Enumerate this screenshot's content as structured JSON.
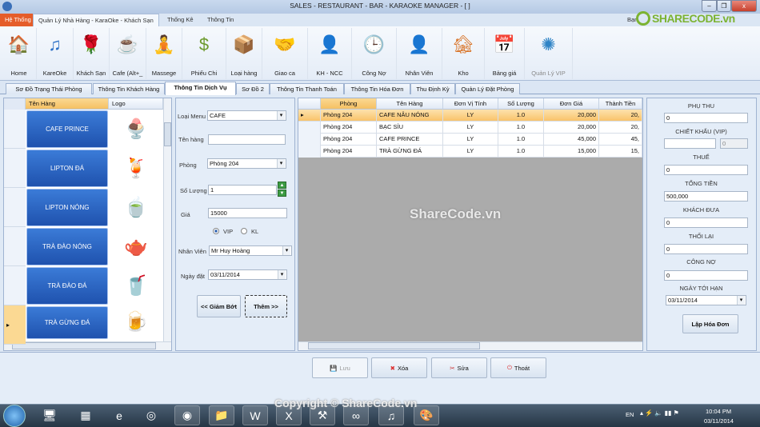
{
  "window": {
    "title": "SALES - RESTAURANT - BAR - KARAOKE MANAGER - [      ]",
    "minimize": "–",
    "restore": "❐",
    "close": "x"
  },
  "menu": {
    "tabs": [
      "Hệ Thống",
      "Quản Lý Nhà Hàng - KaraOke - Khách Sạn",
      "Thống Kê",
      "Thông Tin"
    ],
    "right_text": "Bạn"
  },
  "ribbon": [
    {
      "label": "Home",
      "icon": "house-icon",
      "glyph": "🏠"
    },
    {
      "label": "KareOke",
      "icon": "music-note-icon",
      "glyph": "♫"
    },
    {
      "label": "Khách Sạn",
      "icon": "rose-icon",
      "glyph": "🌹"
    },
    {
      "label": "Cafe (Alt+_",
      "icon": "coffee-cup-icon",
      "glyph": "☕"
    },
    {
      "label": "Massege",
      "icon": "yoga-icon",
      "glyph": "🧘"
    },
    {
      "label": "Phiếu Chi",
      "icon": "money-icon",
      "glyph": "$"
    },
    {
      "label": "Loại hàng",
      "icon": "box-icon",
      "glyph": "📦"
    },
    {
      "label": "Giao ca",
      "icon": "handshake-icon",
      "glyph": "🤝"
    },
    {
      "label": "KH - NCC",
      "icon": "businessman-icon",
      "glyph": "👤"
    },
    {
      "label": "Công Nợ",
      "icon": "clock-icon",
      "glyph": "🕒"
    },
    {
      "label": "Nhân Viên",
      "icon": "employee-icon",
      "glyph": "👤"
    },
    {
      "label": "Kho",
      "icon": "warehouse-icon",
      "glyph": "🏚"
    },
    {
      "label": "Bảng giá",
      "icon": "calendar-icon",
      "glyph": "📅"
    },
    {
      "label": "Quản Lý VIP",
      "icon": "vip-swirl-icon",
      "glyph": "✺"
    }
  ],
  "page_tabs": [
    "Sơ Đồ Trạng Thái Phòng",
    "Thông Tin Khách Hàng",
    "Thông Tin Dịch Vụ",
    "Sơ Đồ 2",
    "Thông Tin Thanh Toán",
    "Thông Tin Hóa Đơn",
    "Thu Định Kỳ",
    "Quản Lý Đặt Phòng"
  ],
  "active_tab": "Thông Tin Dịch Vụ",
  "menu_grid": {
    "headers": [
      "Tên Hàng",
      "Logo"
    ],
    "items": [
      {
        "name": "CAFE PRINCE",
        "logo": "🍨"
      },
      {
        "name": "LIPTON ĐÁ",
        "logo": "🍹"
      },
      {
        "name": "LIPTON NÓNG",
        "logo": "🍵"
      },
      {
        "name": "TRÀ ĐÀO NÓNG",
        "logo": "🫖"
      },
      {
        "name": "TRÀ ĐÀO ĐÁ",
        "logo": "🥤"
      },
      {
        "name": "TRÀ GỪNG ĐÁ",
        "logo": "🍺"
      }
    ]
  },
  "form": {
    "loai_menu_label": "Loại Menu",
    "loai_menu": "CAFE",
    "ten_hang_label": "Tên hàng",
    "ten_hang": "",
    "phong_label": "Phòng",
    "phong": "Phòng 204",
    "so_luong_label": "Số Lượng",
    "so_luong": "1",
    "gia_label": "Giá",
    "gia": "15000",
    "radio_vip": "VIP",
    "radio_kl": "KL",
    "radio_selected": "VIP",
    "nhan_vien_label": "Nhân Viên",
    "nhan_vien": "Mr Huy Hoàng",
    "ngay_dat_label": "Ngày đặt",
    "ngay_dat": "03/11/2014",
    "giam_bot": "<< Giảm Bớt",
    "them": "Thêm >>"
  },
  "order_grid": {
    "headers": [
      "Phòng",
      "Tên Hàng",
      "Đơn Vị Tính",
      "Số Lượng",
      "Đơn Giá",
      "Thành Tiền"
    ],
    "rows": [
      [
        "Phòng 204",
        "CAFE NÂU NÓNG",
        "LY",
        "1.0",
        "20,000",
        "20,"
      ],
      [
        "Phòng 204",
        "BẠC SỈU",
        "LY",
        "1.0",
        "20,000",
        "20,"
      ],
      [
        "Phòng 204",
        "CAFE PRINCE",
        "LY",
        "1.0",
        "45,000",
        "45,"
      ],
      [
        "Phòng 204",
        "TRÀ GỪNG ĐÁ",
        "LY",
        "1.0",
        "15,000",
        "15,"
      ]
    ]
  },
  "summary": {
    "phu_thu_label": "PHỤ THU",
    "phu_thu": "0",
    "chiet_khau_label": "CHIẾT KHẤU (VIP)",
    "chiet_khau": "",
    "chiet_khau_pct": "0",
    "thue_label": "THUẾ",
    "thue": "0",
    "tong_tien_label": "TỔNG TIỀN",
    "tong_tien": "500,000",
    "khach_dua_label": "KHÁCH ĐƯA",
    "khach_dua": "0",
    "thoi_lai_label": "THỐI LẠI",
    "thoi_lai": "0",
    "cong_no_label": "CÔNG NỢ",
    "cong_no": "0",
    "ngay_toi_han_label": "NGÀY TỚI HẠN",
    "ngay_toi_han": "03/11/2014",
    "lap_hoa_don": "Lập Hóa Đơn"
  },
  "actions": {
    "luu": "Lưu",
    "xoa": "Xóa",
    "sua": "Sửa",
    "thoat": "Thoát"
  },
  "watermarks": {
    "center": "ShareCode.vn",
    "bottom": "Copyright © ShareCode.vn",
    "logo": "SHARECODE.vn"
  },
  "taskbar": {
    "lang": "EN",
    "time": "10:04 PM",
    "date": "03/11/2014"
  }
}
